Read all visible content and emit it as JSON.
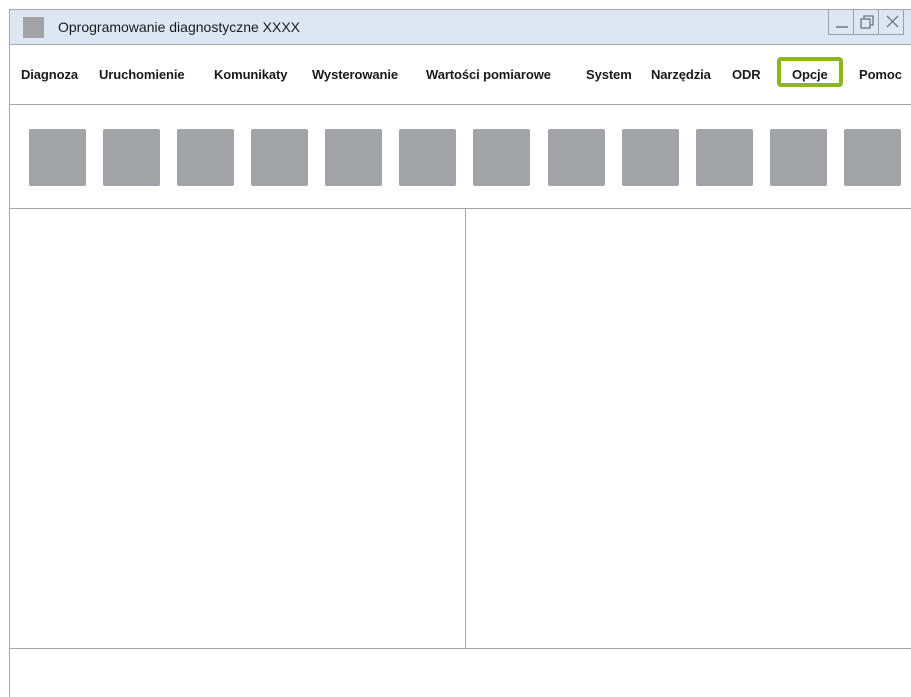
{
  "window": {
    "title": "Oprogramowanie diagnostyczne XXXX"
  },
  "menu": {
    "items": [
      {
        "id": "diagnoza",
        "label": "Diagnoza"
      },
      {
        "id": "uruchomienie",
        "label": "Uruchomienie"
      },
      {
        "id": "komunikaty",
        "label": "Komunikaty"
      },
      {
        "id": "wysterowanie",
        "label": "Wysterowanie"
      },
      {
        "id": "wartosci",
        "label": "Wartości pomiarowe"
      },
      {
        "id": "system",
        "label": "System"
      },
      {
        "id": "narzedzia",
        "label": "Narzędzia"
      },
      {
        "id": "odr",
        "label": "ODR"
      },
      {
        "id": "opcje",
        "label": "Opcje",
        "highlighted": true
      },
      {
        "id": "pomoc",
        "label": "Pomoc"
      }
    ]
  },
  "colors": {
    "highlight": "#8cb51e",
    "titlebar": "#dde7f3",
    "placeholder": "#a2a3a6",
    "border": "#a6a6a6"
  },
  "toolbar": {
    "button_count": 12
  }
}
